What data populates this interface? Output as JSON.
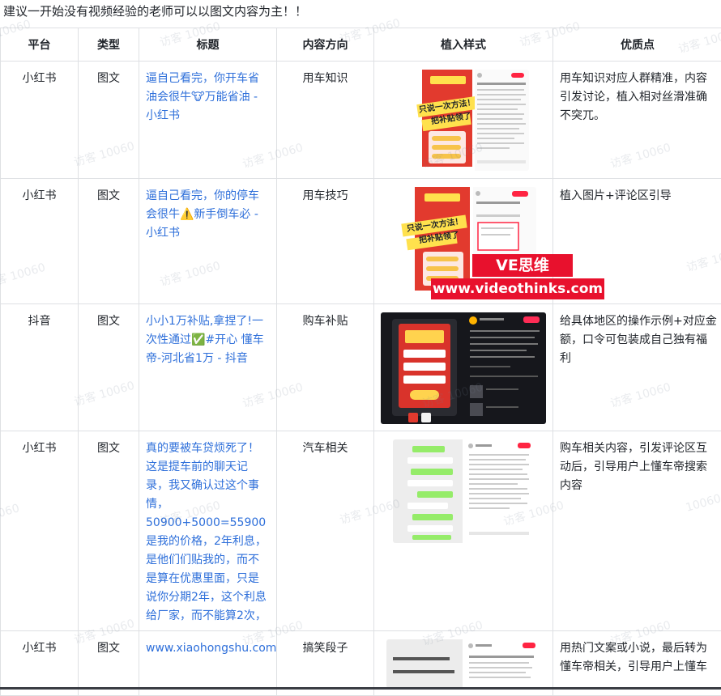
{
  "intro": "建议一开始没有视频经验的老师可以以图文内容为主！！",
  "headers": [
    "平台",
    "类型",
    "标题",
    "内容方向",
    "植入样式",
    "优质点"
  ],
  "rows": [
    {
      "platform": "小红书",
      "type": "图文",
      "title": "逼自己看完，你开车省油会很牛🐮万能省油 - 小红书",
      "direction": "用车知识",
      "highlight": "用车知识对应人群精准，内容引发讨论，植入相对丝滑准确不突兀。",
      "poster": {
        "line1": "只说一次方法！",
        "line2": "把补贴领了"
      }
    },
    {
      "platform": "小红书",
      "type": "图文",
      "title": "逼自己看完，你的停车会很牛⚠️新手倒车必 - 小红书",
      "direction": "用车技巧",
      "highlight": "植入图片+评论区引导",
      "poster": {
        "line1": "只说一次方法！",
        "line2": "把补贴领了"
      }
    },
    {
      "platform": "抖音",
      "type": "图文",
      "title": "小小1万补贴,拿捏了!一次性通过✅#开心 懂车帝-河北省1万 - 抖音",
      "direction": "购车补贴",
      "highlight": "给具体地区的操作示例+对应金额，口令可包装成自己独有福利"
    },
    {
      "platform": "小红书",
      "type": "图文",
      "title": "真的要被车贷烦死了！这是提车前的聊天记录，我又确认过这个事情，50900+5000=55900是我的价格，2年利息，是他们们贴我的，而不是算在优惠里面，只是说你分期2年，这个利息给厂家，而不能算2次，",
      "direction": "汽车相关",
      "highlight": "购车相关内容，引发评论区互动后，引导用户上懂车帝搜索内容"
    },
    {
      "platform": "小红书",
      "type": "图文",
      "title": "www.xiaohongshu.com",
      "direction": "搞笑段子",
      "highlight": "用热门文案或小说，最后转为懂车帝相关，引导用户上懂车"
    }
  ],
  "overlay": {
    "brand": "VE思维",
    "url": "www.videothinks.com"
  },
  "watermark": "访客 10060",
  "colors": {
    "link": "#2e6fda",
    "border": "#dee0e3",
    "overlay_red": "#e8112d",
    "poster_red": "#e23a2e",
    "poster_yellow": "#ffe14d"
  }
}
